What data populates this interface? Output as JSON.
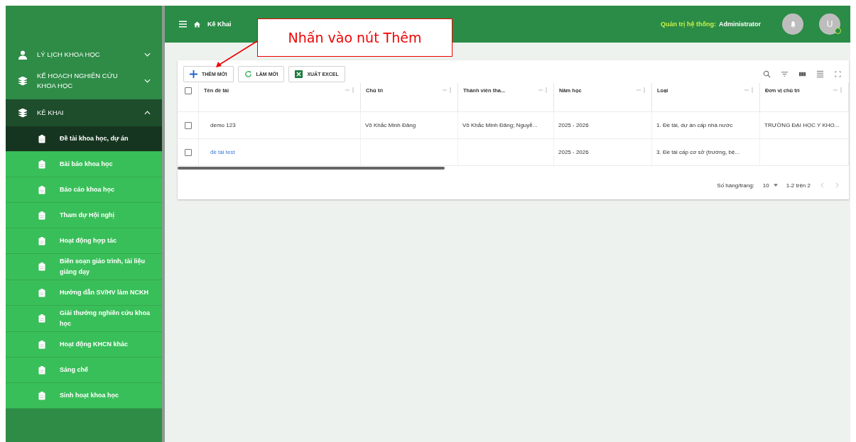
{
  "header": {
    "breadcrumb": [
      {
        "label": "Kê Khai"
      }
    ],
    "role_label": "Quản trị hệ thống:",
    "user_name": "Administrator",
    "avatar_letter": "U"
  },
  "sidebar": {
    "items": [
      {
        "label": "LÝ LỊCH KHOA HỌC",
        "kind": "person",
        "expanded": false
      },
      {
        "label": "KẾ HOẠCH NGHIÊN CỨU KHOA HỌC",
        "kind": "stack",
        "expanded": false
      },
      {
        "label": "KÊ KHAI",
        "kind": "stack",
        "expanded": true,
        "children": [
          {
            "label": "Đề tài khoa học, dự án",
            "selected": true
          },
          {
            "label": "Bài báo khoa học",
            "selected": false
          },
          {
            "label": "Báo cáo khoa học",
            "selected": false
          },
          {
            "label": "Tham dự Hội nghị",
            "selected": false
          },
          {
            "label": "Hoạt động hợp tác",
            "selected": false
          },
          {
            "label": "Biên soạn giáo trình, tài liệu giảng dạy",
            "selected": false
          },
          {
            "label": "Hướng dẫn SV/HV làm NCKH",
            "selected": false
          },
          {
            "label": "Giải thưởng nghiên cứu khoa học",
            "selected": false
          },
          {
            "label": "Hoạt động KHCN khác",
            "selected": false
          },
          {
            "label": "Sáng chế",
            "selected": false
          },
          {
            "label": "Sinh hoạt khoa học",
            "selected": false
          }
        ]
      }
    ]
  },
  "toolbar": {
    "buttons": [
      {
        "label": "THÊM MỚI",
        "kind": "add"
      },
      {
        "label": "LÀM MỚI",
        "kind": "refresh"
      },
      {
        "label": "XUẤT EXCEL",
        "kind": "excel"
      }
    ]
  },
  "table": {
    "header_checked": false,
    "columns": [
      "Tên đề tài",
      "Chủ trì",
      "Thành viên tha...",
      "Năm học",
      "Loại",
      "Đơn vị chủ trì"
    ],
    "rows": [
      {
        "checked": false,
        "link": false,
        "cells": [
          "demo 123",
          "Võ Khắc Minh Đăng",
          "Võ Khắc Minh Đăng; Nguyễ...",
          "2025 - 2026",
          "1. Đề tài, dự án cấp nhà nước",
          "TRƯỜNG ĐẠI HỌC Y KHO..."
        ]
      },
      {
        "checked": false,
        "link": true,
        "cells": [
          "đề tài test",
          null,
          null,
          "2025 - 2026",
          "3. Đề tài cấp cơ sở (trường, bệ...",
          null
        ]
      }
    ]
  },
  "pagination": {
    "rows_per_page_label": "Số hàng/trang:",
    "rows_per_page": "10",
    "range": "1-2 trên 2"
  },
  "callout": {
    "text": "Nhấn vào nút Thêm"
  }
}
